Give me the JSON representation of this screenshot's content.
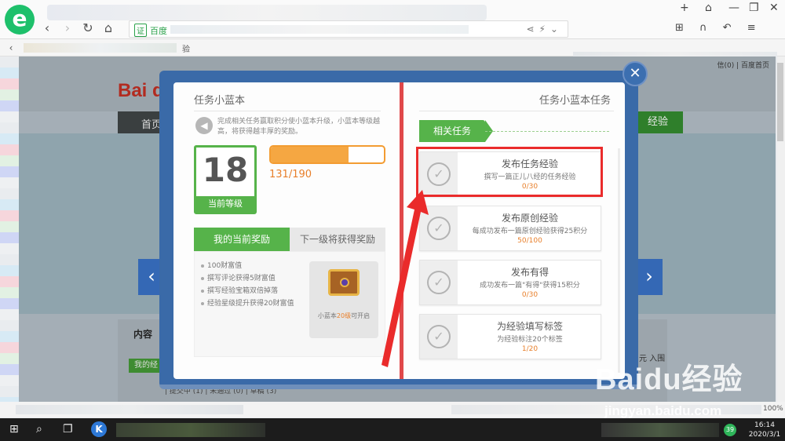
{
  "browser": {
    "address_label": "百度",
    "bookmark_text": "验",
    "top_links": "信(0) | 百度首页",
    "zoom": "100%"
  },
  "background_page": {
    "logo": "Bai du",
    "nav_home": "首页",
    "nav_experience": "经验",
    "content_title": "内容",
    "my_exp_button": "我的经",
    "drafts": "| 提交中 (1) | 未通过 (0) | 草稿 (3)",
    "right_text": "元\n入围"
  },
  "modal": {
    "left": {
      "title": "任务小蓝本",
      "description": "完成相关任务赢取积分使小蓝本升级，小蓝本等级越高，将获得越丰厚的奖励。",
      "level": "18",
      "level_label": "当前等级",
      "progress_text": "131/190",
      "progress_fraction": 0.69,
      "tab_current": "我的当前奖励",
      "tab_next": "下一级将获得奖励",
      "rewards": [
        "100财富值",
        "撰写评论获得5财富值",
        "撰写经验宝箱双倍掉落",
        "经验星级提升获得20财富值"
      ],
      "chest_text_prefix": "小蓝本",
      "chest_text_highlight": "20级",
      "chest_text_suffix": "可开启"
    },
    "right": {
      "title": "任务小蓝本任务",
      "related_tag": "相关任务",
      "tasks": [
        {
          "name": "发布任务经验",
          "desc": "撰写一篇正儿八经的任务经验",
          "progress": "0/30"
        },
        {
          "name": "发布原创经验",
          "desc": "每成功发布一篇原创经验获得25积分",
          "progress": "50/100"
        },
        {
          "name": "发布有得",
          "desc": "成功发布一篇\"有得\"获得15积分",
          "progress": "0/30"
        },
        {
          "name": "为经验填写标签",
          "desc": "为经验标注20个标签",
          "progress": "1/20"
        }
      ]
    }
  },
  "watermark": {
    "logo": "Baidu经验",
    "url": "jingyan.baidu.com"
  },
  "taskbar": {
    "tray_badge": "39",
    "time": "16:14",
    "date": "2020/3/1"
  },
  "colors": {
    "accent_green": "#56b34a",
    "progress_orange": "#f5a742",
    "book_blue": "#3a6aa8",
    "highlight_red": "#ea2b2b"
  }
}
